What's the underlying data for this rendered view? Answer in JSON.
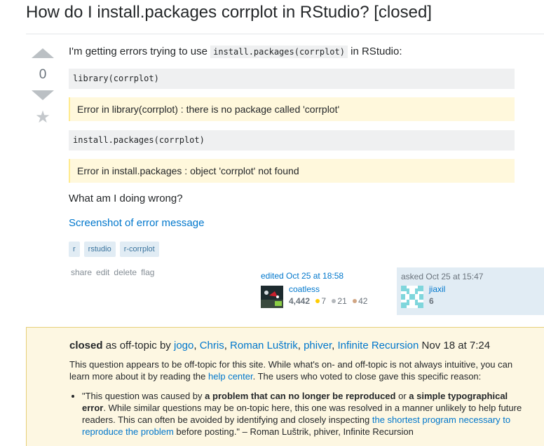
{
  "question": {
    "title": "How do I install.packages corrplot in RStudio? [closed]",
    "vote_count": "0",
    "intro_before": "I'm getting errors trying to use ",
    "intro_code": "install.packages(corrplot)",
    "intro_after": " in RStudio:",
    "code1": "library(corrplot)",
    "error1": "Error in library(corrplot) : there is no package called 'corrplot'",
    "code2": "install.packages(corrplot)",
    "error2": "Error in install.packages : object 'corrplot' not found",
    "question_line": "What am I doing wrong?",
    "screenshot_link": "Screenshot of error message",
    "tags": [
      "r",
      "rstudio",
      "r-corrplot"
    ]
  },
  "post_menu": {
    "share": "share",
    "edit": "edit",
    "delete": "delete",
    "flag": "flag"
  },
  "edited": {
    "when": "edited Oct 25 at 18:58",
    "user": "coatless",
    "rep": "4,442",
    "gold": "7",
    "silver": "21",
    "bronze": "42"
  },
  "asked": {
    "when": "asked Oct 25 at 15:47",
    "user": "jiaxil",
    "rep": "6"
  },
  "closed": {
    "label": "closed",
    "as": " as off-topic by ",
    "voters": [
      "jogo",
      "Chris",
      "Roman Luštrik",
      "phiver",
      "Infinite Recursion"
    ],
    "date": " Nov 18 at 7:24",
    "desc_before": "This question appears to be off-topic for this site. While what's on- and off-topic is not always intuitive, you can learn more about it by reading the ",
    "help_center": "help center",
    "desc_after": ". The users who voted to close gave this specific reason:",
    "reason_q1": "\"This question was caused by ",
    "reason_b1": "a problem that can no longer be reproduced",
    "reason_or": " or ",
    "reason_b2": "a simple typographical error",
    "reason_mid": ". While similar questions may be on-topic here, this one was resolved in a manner unlikely to help future readers. This can often be avoided by identifying and closely inspecting ",
    "reason_link": "the shortest program necessary to reproduce the problem",
    "reason_end": " before posting.\" – Roman Luštrik, phiver, Infinite Recursion"
  },
  "colors": {
    "link": "#0077cc",
    "gold": "#ffcc01",
    "silver": "#b4b8bc",
    "bronze": "#d1a684"
  }
}
